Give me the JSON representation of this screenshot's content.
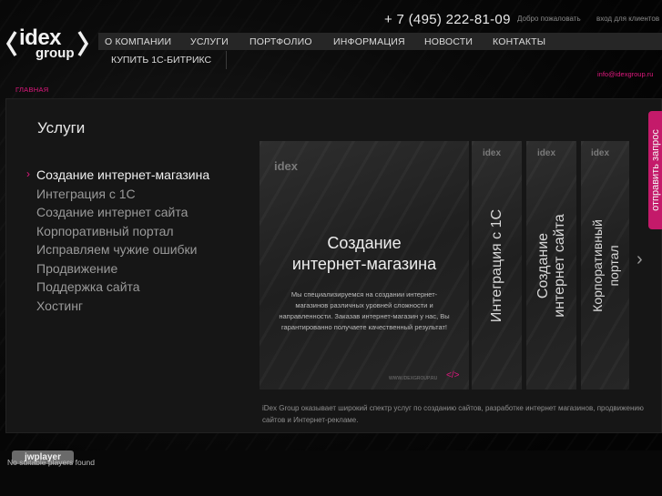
{
  "header": {
    "logo": {
      "line1": "idex",
      "line2": "group"
    },
    "phone": "+ 7 (495) 222-81-09",
    "welcome": "Добро пожаловать",
    "login": "вход для клиентов",
    "email": "info@idexgroup.ru"
  },
  "nav": {
    "items": [
      "О КОМПАНИИ",
      "УСЛУГИ",
      "ПОРТФОЛИО",
      "ИНФОРМАЦИЯ",
      "НОВОСТИ",
      "КОНТАКТЫ"
    ],
    "sub": "КУПИТЬ 1С-БИТРИКС"
  },
  "breadcrumb": "ГЛАВНАЯ",
  "main": {
    "title": "Услуги",
    "services": [
      "Создание интернет-магазина",
      "Интеграция с 1С",
      "Создание интернет сайта",
      "Корпоративный портал",
      "Исправляем чужие ошибки",
      "Продвижение",
      "Поддержка сайта",
      "Хостинг"
    ],
    "active_index": 0,
    "cards": {
      "main": {
        "title_line1": "Создание",
        "title_line2": "интернет-магазина",
        "desc": "Мы специализируемся на создании интернет-магазинов различных уровней сложности и направленности. Заказав интернет-магазин у нас, Вы гарантированно получаете качественный результат!",
        "footer": "WWW.IDEXGROUP.RU",
        "code": "</>"
      },
      "side1": {
        "line1": "Интеграция с 1С",
        "line2": ""
      },
      "side2": {
        "line1": "Создание",
        "line2": "интернет сайта"
      },
      "side3": {
        "line1": "Корпоративный",
        "line2": "портал"
      }
    },
    "description": "iDex Group оказывает широкий спектр услуг по созданию сайтов, разработке интернет магазинов, продвижению сайтов и Интернет-рекламе."
  },
  "side_tab": "отправить запрос",
  "footer": {
    "jw_label": "jwplayer",
    "no_players": "No suitable players found"
  },
  "colors": {
    "accent": "#e0187e",
    "side_tab": "#c41a6a"
  }
}
